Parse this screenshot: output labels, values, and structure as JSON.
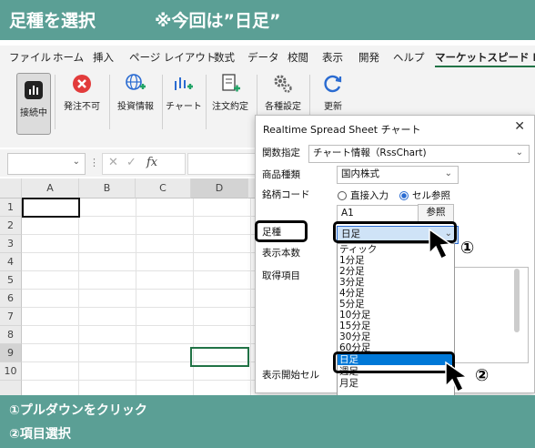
{
  "banner": {
    "title": "足種を選択",
    "note": "※今回は”日足”"
  },
  "ribbon_tabs": [
    "ファイル",
    "ホーム",
    "挿入",
    "ページ レイアウト",
    "数式",
    "データ",
    "校閲",
    "表示",
    "開発",
    "ヘルプ",
    "マーケットスピード II"
  ],
  "ribbon_buttons": [
    "接続中",
    "発注不可",
    "投資情報",
    "チャート",
    "注文約定",
    "各種設定",
    "更新"
  ],
  "formula_bar": {
    "fx": "fx",
    "cancel": "✕",
    "confirm": "✓"
  },
  "grid": {
    "columns": [
      "A",
      "B",
      "C",
      "D"
    ],
    "rows": [
      "1",
      "2",
      "3",
      "4",
      "5",
      "6",
      "7",
      "8",
      "9",
      "10"
    ]
  },
  "dialog": {
    "title": "Realtime Spread Sheet チャート",
    "close": "✕",
    "func_label": "関数指定",
    "func_value": "チャート情報（RssChart)",
    "product_label": "商品種類",
    "product_value": "国内株式",
    "code_label": "銘柄コード",
    "radio_direct": "直接入力",
    "radio_cell": "セル参照",
    "code_value": "A1",
    "ref_button": "参照",
    "ashi_label": "足種",
    "ashi_value": "日足",
    "count_label": "表示本数",
    "items_label": "取得項目",
    "start_label": "表示開始セル",
    "options": [
      "ティック",
      "1分足",
      "2分足",
      "3分足",
      "4分足",
      "5分足",
      "10分足",
      "15分足",
      "30分足",
      "60分足",
      "日足",
      "週足",
      "月足"
    ],
    "selected_option": "日足"
  },
  "callouts": {
    "one": "①",
    "two": "②"
  },
  "bottom": {
    "step1": "①プルダウンをクリック",
    "step2": "②項目選択"
  },
  "colors": {
    "banner": "#5b9f95",
    "highlight": "#0078d7",
    "excel_green": "#217346"
  }
}
